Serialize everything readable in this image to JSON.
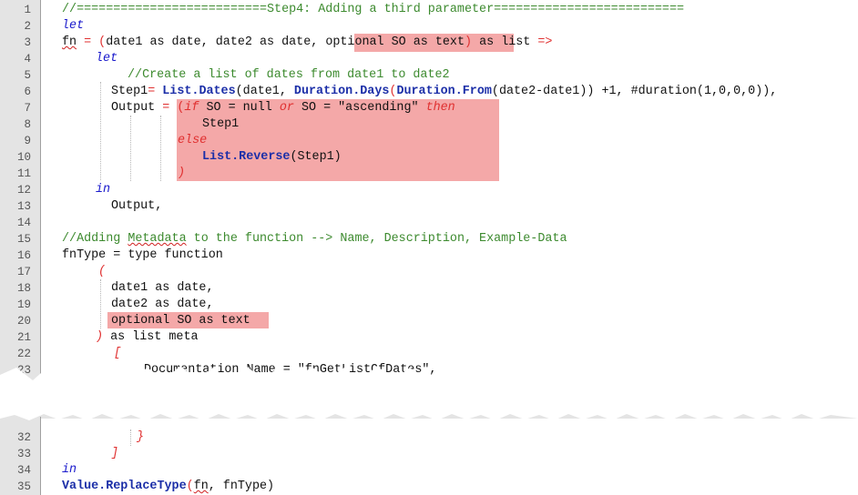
{
  "colors": {
    "comment": "#3c8a2e",
    "keyword": "#1a1acc",
    "operator": "#e03030",
    "function": "#1c2fa8",
    "highlight": "#f4a8a8",
    "gutter": "#e4e4e4"
  },
  "line_numbers": {
    "l1": "1",
    "l2": "2",
    "l3": "3",
    "l4": "4",
    "l5": "5",
    "l6": "6",
    "l7": "7",
    "l8": "8",
    "l9": "9",
    "l10": "10",
    "l11": "11",
    "l12": "12",
    "l13": "13",
    "l14": "14",
    "l15": "15",
    "l16": "16",
    "l17": "17",
    "l18": "18",
    "l19": "19",
    "l20": "20",
    "l21": "21",
    "l22": "22",
    "l23": "23",
    "l32": "32",
    "l33": "33",
    "l34": "34",
    "l35": "35"
  },
  "code": {
    "l1": "//==========================Step4: Adding a third parameter==========================",
    "l2_kw": "let",
    "l3_fn": "fn",
    "l3_eq": " = (",
    "l3_params": "date1 as date, date2 as date, ",
    "l3_opt": "optional SO as text",
    "l3_close": ")",
    "l3_rest": " as list ",
    "l3_arrow": "=>",
    "l4_kw": "let",
    "l5": "//Create a list of dates from date1 to date2",
    "l6_a": "Step1",
    "l6_b": "= ",
    "l6_fn1": "List.Dates",
    "l6_c": "(date1, ",
    "l6_fn2": "Duration.Days",
    "l6_d": "(",
    "l6_fn3": "Duration.From",
    "l6_e": "(date2-date1)) +1, #duration(1,0,0,0)),",
    "l7_a": "Output ",
    "l7_b": "= (",
    "l7_if": "if",
    "l7_c": " SO = null ",
    "l7_or": "or",
    "l7_d": " SO = \"ascending\" ",
    "l7_then": "then",
    "l8": "Step1",
    "l9_else": "else",
    "l10_fn": "List.Reverse",
    "l10_rest": "(Step1)",
    "l11": ")",
    "l12_kw": "in",
    "l13": "Output,",
    "l16_comment_a": "//Adding ",
    "l16_comment_sq": "Metadata",
    "l16_comment_b": " to the function --> Name, Description, Example-Data",
    "l17_a": "fnType ",
    "l17_b": "= type function",
    "l18": "(",
    "l19": "date1 as date,",
    "l20": "date2 as date,",
    "l21": "optional SO as text",
    "l22_paren": ")",
    "l22_rest": " as list meta",
    "l23": "[",
    "l24_a": "Documentation.Name ",
    "l24_b": "= \"fnGetListOfDates\",",
    "l32": "}",
    "l33": "]",
    "l34_kw": "in",
    "l35_fn": "Value.ReplaceType",
    "l35_a": "(",
    "l35_sq": "fn",
    "l35_b": ", fnType)"
  }
}
